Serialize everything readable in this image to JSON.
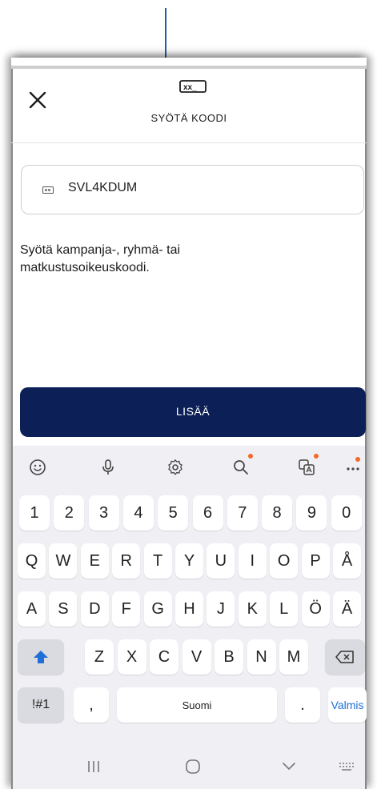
{
  "header": {
    "icon_text": "xx_",
    "title": "SYÖTÄ KOODI"
  },
  "code_field": {
    "value": "SVL4KDUM"
  },
  "helper_text": "Syötä kampanja-, ryhmä- tai matkustusoikeuskoodi.",
  "add_button_label": "LISÄÄ",
  "keyboard": {
    "row_numbers": [
      "1",
      "2",
      "3",
      "4",
      "5",
      "6",
      "7",
      "8",
      "9",
      "0"
    ],
    "row_q": [
      "Q",
      "W",
      "E",
      "R",
      "T",
      "Y",
      "U",
      "I",
      "O",
      "P",
      "Å"
    ],
    "row_a": [
      "A",
      "S",
      "D",
      "F",
      "G",
      "H",
      "J",
      "K",
      "L",
      "Ö",
      "Ä"
    ],
    "row_z": [
      "Z",
      "X",
      "C",
      "V",
      "B",
      "N",
      "M"
    ],
    "symbols_label": "!#1",
    "comma_label": ",",
    "space_label": "Suomi",
    "period_label": ".",
    "done_label": "Valmis",
    "accent_color": "#1f6fd6",
    "notification_color": "#f06a2a"
  },
  "toolbar_icons": [
    "emoji-icon",
    "mic-icon",
    "settings-icon",
    "search-icon",
    "translate-icon",
    "more-icon"
  ],
  "navbar_icons": [
    "recent-apps-icon",
    "home-icon",
    "back-icon",
    "keyboard-switch-icon"
  ]
}
